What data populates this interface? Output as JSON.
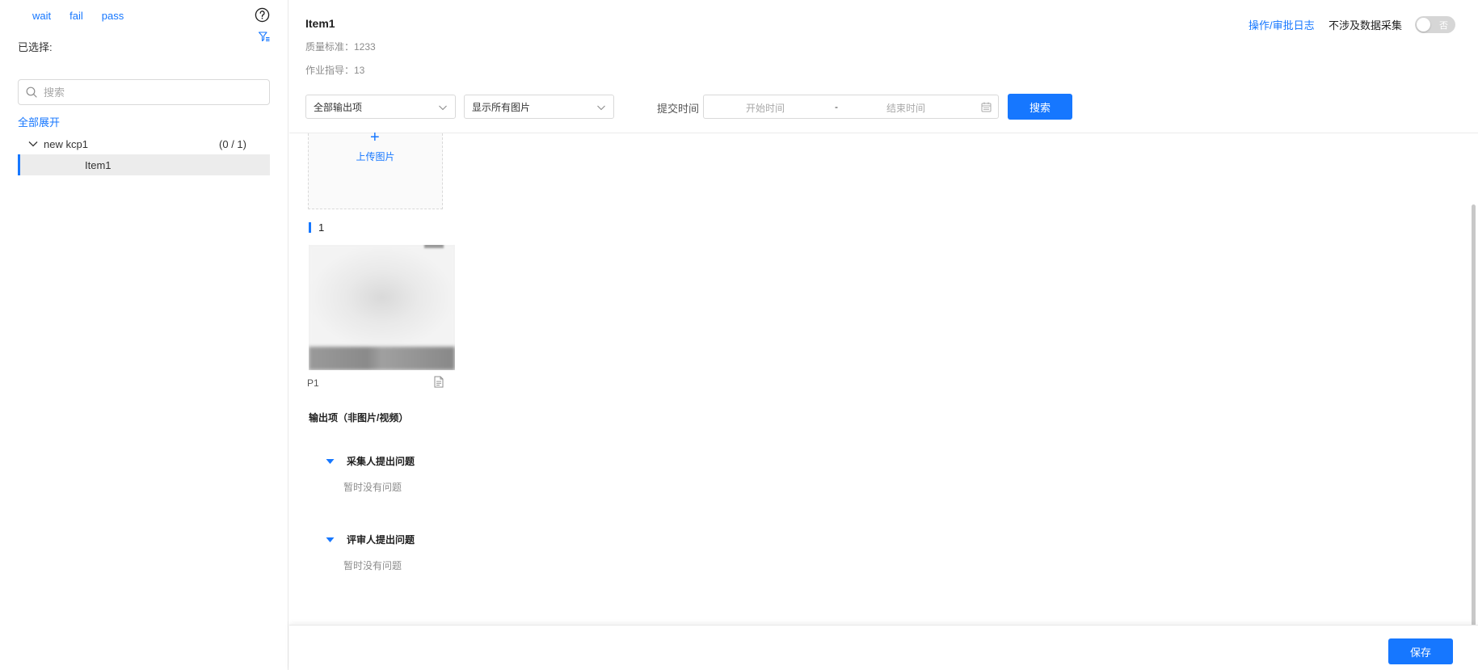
{
  "sidebar": {
    "status_tabs": [
      "wait",
      "fail",
      "pass"
    ],
    "selected_label": "已选择:",
    "search_placeholder": "搜索",
    "expand_all": "全部展开",
    "tree": {
      "node_label": "new kcp1",
      "node_count": "(0 / 1)",
      "leaf_label": "Item1"
    }
  },
  "header": {
    "title": "Item1",
    "quality_standard": "质量标准：1233",
    "work_guide": "作业指导：13",
    "log_link": "操作/审批日志",
    "no_collect_label": "不涉及数据采集",
    "toggle_text": "否"
  },
  "filters": {
    "output_select": "全部输出项",
    "image_select": "显示所有图片",
    "submit_time_label": "提交时间",
    "start_placeholder": "开始时间",
    "range_separator": "-",
    "end_placeholder": "结束时间",
    "search_button": "搜索"
  },
  "content": {
    "upload_label": "上传图片",
    "section_number": "1",
    "image_label": "P1",
    "outputs_title": "输出项（非图片/视频）",
    "issue_groups": [
      {
        "title": "采集人提出问题",
        "empty_text": "暂时没有问题"
      },
      {
        "title": "评审人提出问题",
        "empty_text": "暂时没有问题"
      }
    ]
  },
  "footer": {
    "save_button": "保存"
  },
  "colors": {
    "accent": "#1677ff",
    "muted_text": "#8c8c8c",
    "border": "#d9d9d9"
  },
  "icons": [
    "help-icon",
    "filter-icon",
    "search-icon",
    "chevron-down-icon",
    "calendar-icon",
    "plus-icon",
    "document-icon",
    "caret-down-icon"
  ]
}
